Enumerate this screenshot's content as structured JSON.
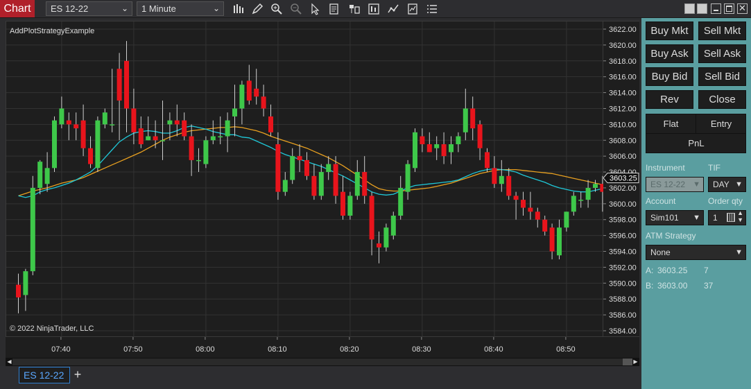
{
  "window": {
    "title_tab": "Chart"
  },
  "toolbar": {
    "instrument": "ES 12-22",
    "interval": "1 Minute",
    "icons": [
      "bar-type-icon",
      "draw-pencil-icon",
      "zoom-in-icon",
      "zoom-out-icon",
      "pointer-icon",
      "properties-icon",
      "instrument-overlay-icon",
      "chart-trader-icon",
      "strategies-icon",
      "indicators-icon",
      "list-icon"
    ]
  },
  "chart": {
    "label": "AddPlotStrategyExample",
    "copyright": "© 2022 NinjaTrader, LLC",
    "price_labels": [
      "3622.00",
      "3620.00",
      "3618.00",
      "3616.00",
      "3614.00",
      "3612.00",
      "3610.00",
      "3608.00",
      "3606.00",
      "3604.00",
      "3602.00",
      "3600.00",
      "3598.00",
      "3596.00",
      "3594.00",
      "3592.00",
      "3590.00",
      "3588.00",
      "3586.00",
      "3584.00"
    ],
    "time_labels": [
      "07:40",
      "07:50",
      "08:00",
      "08:10",
      "08:20",
      "08:30",
      "08:40",
      "08:50"
    ],
    "current_price": "3603.25",
    "colors": {
      "up": "#3ec84a",
      "down": "#e8141c",
      "wick": "#cfcfcf",
      "sma_fast": "#1fc8d8",
      "sma_slow": "#e8a020",
      "bg": "#1e1e1e",
      "grid": "#333"
    }
  },
  "chart_data": {
    "type": "candlestick",
    "ylim": [
      3583,
      3623
    ],
    "candles": [
      [
        3589.8,
        3591.2,
        3586.2,
        3588.2
      ],
      [
        3588.5,
        3591.8,
        3586.5,
        3591.5
      ],
      [
        3591.5,
        3603.5,
        3591.0,
        3602.0
      ],
      [
        3602.0,
        3605.5,
        3601.2,
        3605.3
      ],
      [
        3602.5,
        3606.5,
        3601.5,
        3604.5
      ],
      [
        3604.5,
        3611.0,
        3604.0,
        3610.5
      ],
      [
        3610.0,
        3613.5,
        3609.5,
        3612.0
      ],
      [
        3610.5,
        3611.5,
        3608.0,
        3610.0
      ],
      [
        3610.0,
        3611.5,
        3608.0,
        3609.5
      ],
      [
        3610.5,
        3612.5,
        3606.0,
        3607.0
      ],
      [
        3607.0,
        3608.5,
        3604.5,
        3605.0
      ],
      [
        3604.5,
        3611.0,
        3604.0,
        3610.5
      ],
      [
        3610.0,
        3612.0,
        3609.5,
        3611.5
      ],
      [
        3610.0,
        3617.0,
        3609.0,
        3610.0
      ],
      [
        3617.0,
        3619.0,
        3608.0,
        3613.0
      ],
      [
        3618.0,
        3620.5,
        3609.0,
        3612.0
      ],
      [
        3612.0,
        3614.5,
        3607.5,
        3609.0
      ],
      [
        3609.5,
        3611.0,
        3607.0,
        3607.5
      ],
      [
        3608.0,
        3611.0,
        3608.0,
        3608.5
      ],
      [
        3608.5,
        3610.5,
        3607.0,
        3608.0
      ],
      [
        3608.0,
        3613.0,
        3605.5,
        3608.0
      ],
      [
        3610.0,
        3611.5,
        3608.0,
        3610.5
      ],
      [
        3610.5,
        3612.5,
        3608.5,
        3610.0
      ],
      [
        3610.5,
        3611.5,
        3608.0,
        3608.5
      ],
      [
        3608.5,
        3610.0,
        3603.5,
        3605.5
      ],
      [
        3605.5,
        3607.0,
        3604.0,
        3605.5
      ],
      [
        3605.0,
        3608.5,
        3604.5,
        3608.0
      ],
      [
        3608.0,
        3610.5,
        3607.5,
        3608.5
      ],
      [
        3608.5,
        3611.0,
        3607.5,
        3608.5
      ],
      [
        3608.5,
        3611.5,
        3606.5,
        3610.5
      ],
      [
        3611.0,
        3615.0,
        3608.5,
        3612.0
      ],
      [
        3612.0,
        3615.5,
        3610.0,
        3615.0
      ],
      [
        3615.5,
        3617.5,
        3612.5,
        3613.0
      ],
      [
        3614.5,
        3617.0,
        3612.5,
        3613.5
      ],
      [
        3613.5,
        3615.0,
        3611.0,
        3612.0
      ],
      [
        3611.0,
        3612.5,
        3608.5,
        3609.0
      ],
      [
        3607.5,
        3609.0,
        3600.5,
        3601.5
      ],
      [
        3601.5,
        3604.0,
        3601.0,
        3603.0
      ],
      [
        3603.0,
        3607.0,
        3602.5,
        3606.0
      ],
      [
        3606.0,
        3607.5,
        3604.0,
        3605.5
      ],
      [
        3605.5,
        3606.5,
        3603.0,
        3603.5
      ],
      [
        3603.5,
        3605.0,
        3600.5,
        3601.0
      ],
      [
        3601.0,
        3605.0,
        3600.5,
        3604.0
      ],
      [
        3604.0,
        3606.0,
        3603.0,
        3605.0
      ],
      [
        3605.0,
        3606.0,
        3600.0,
        3601.0
      ],
      [
        3601.5,
        3603.5,
        3598.0,
        3598.5
      ],
      [
        3598.5,
        3601.5,
        3598.0,
        3601.0
      ],
      [
        3601.0,
        3605.5,
        3600.5,
        3604.0
      ],
      [
        3604.0,
        3606.0,
        3600.0,
        3601.0
      ],
      [
        3601.0,
        3601.5,
        3593.5,
        3595.5
      ],
      [
        3595.0,
        3596.5,
        3592.5,
        3594.5
      ],
      [
        3594.5,
        3597.5,
        3594.0,
        3597.0
      ],
      [
        3596.0,
        3599.0,
        3595.5,
        3598.5
      ],
      [
        3598.5,
        3603.5,
        3598.0,
        3602.0
      ],
      [
        3601.5,
        3605.5,
        3600.5,
        3605.0
      ],
      [
        3604.5,
        3609.5,
        3604.0,
        3609.0
      ],
      [
        3608.5,
        3609.5,
        3606.5,
        3607.5
      ],
      [
        3607.5,
        3609.0,
        3606.5,
        3606.5
      ],
      [
        3607.0,
        3608.5,
        3605.5,
        3607.5
      ],
      [
        3607.5,
        3609.0,
        3605.0,
        3606.0
      ],
      [
        3606.5,
        3608.5,
        3605.0,
        3607.5
      ],
      [
        3607.5,
        3609.0,
        3606.5,
        3608.5
      ],
      [
        3609.0,
        3614.5,
        3608.0,
        3612.0
      ],
      [
        3612.0,
        3613.5,
        3608.0,
        3609.5
      ],
      [
        3610.0,
        3610.5,
        3605.5,
        3607.0
      ],
      [
        3606.5,
        3607.0,
        3604.0,
        3604.5
      ],
      [
        3604.5,
        3606.0,
        3602.0,
        3602.5
      ],
      [
        3602.5,
        3605.5,
        3601.5,
        3603.5
      ],
      [
        3603.5,
        3604.5,
        3600.5,
        3601.0
      ],
      [
        3601.0,
        3601.5,
        3598.0,
        3600.5
      ],
      [
        3600.5,
        3601.5,
        3598.5,
        3599.5
      ],
      [
        3599.5,
        3601.5,
        3598.0,
        3599.0
      ],
      [
        3599.0,
        3599.5,
        3597.0,
        3598.0
      ],
      [
        3598.0,
        3598.5,
        3596.0,
        3596.5
      ],
      [
        3597.0,
        3597.5,
        3593.0,
        3594.0
      ],
      [
        3593.5,
        3598.0,
        3593.0,
        3597.0
      ],
      [
        3597.0,
        3599.0,
        3596.5,
        3599.0
      ],
      [
        3599.0,
        3601.5,
        3598.5,
        3601.0
      ],
      [
        3600.5,
        3601.5,
        3599.5,
        3600.5
      ],
      [
        3600.5,
        3603.0,
        3599.5,
        3602.0
      ],
      [
        3602.0,
        3603.0,
        3601.5,
        3602.5
      ],
      [
        3602.5,
        3603.5,
        3599.0,
        3601.5
      ],
      [
        3601.5,
        3604.0,
        3600.5,
        3603.25
      ]
    ],
    "sma_fast": [
      3601.0,
      3600.8,
      3601.0,
      3601.5,
      3601.8,
      3602.0,
      3602.3,
      3602.6,
      3603.0,
      3603.5,
      3604.0,
      3604.8,
      3605.8,
      3606.8,
      3607.8,
      3608.4,
      3608.9,
      3609.1,
      3609.2,
      3609.1,
      3608.9,
      3608.9,
      3609.2,
      3609.6,
      3609.8,
      3609.6,
      3609.4,
      3609.1,
      3608.9,
      3608.7,
      3608.7,
      3608.4,
      3608.3,
      3607.9,
      3607.5,
      3607.1,
      3606.6,
      3606.2,
      3605.9,
      3605.6,
      3605.3,
      3605.0,
      3604.7,
      3604.3,
      3603.9,
      3603.5,
      3603.0,
      3602.5,
      3602.0,
      3601.5,
      3601.2,
      3601.1,
      3601.2,
      3601.6,
      3602.0,
      3602.3,
      3602.4,
      3602.5,
      3602.6,
      3602.7,
      3602.8,
      3603.0,
      3603.4,
      3603.8,
      3604.1,
      3604.3,
      3604.4,
      3604.3,
      3604.2,
      3604.0,
      3603.6,
      3603.3,
      3603.0,
      3602.7,
      3602.3,
      3602.0,
      3601.8,
      3601.6,
      3601.5,
      3601.5,
      3601.7,
      3601.9,
      3602.1
    ],
    "sma_slow": [
      3601.0,
      3601.3,
      3601.6,
      3601.8,
      3602.0,
      3602.3,
      3602.6,
      3602.8,
      3603.0,
      3603.3,
      3603.7,
      3604.1,
      3604.5,
      3604.9,
      3605.3,
      3605.7,
      3606.1,
      3606.5,
      3607.0,
      3607.5,
      3608.0,
      3608.4,
      3608.7,
      3609.0,
      3609.2,
      3609.3,
      3609.4,
      3609.5,
      3609.6,
      3609.6,
      3609.7,
      3609.6,
      3609.4,
      3609.2,
      3608.9,
      3608.5,
      3608.2,
      3607.9,
      3607.6,
      3607.3,
      3607.0,
      3606.6,
      3606.2,
      3605.8,
      3605.3,
      3604.8,
      3604.2,
      3603.6,
      3603.0,
      3602.4,
      3601.9,
      3601.7,
      3601.6,
      3601.6,
      3601.7,
      3601.8,
      3601.9,
      3602.0,
      3602.2,
      3602.4,
      3602.6,
      3602.9,
      3603.2,
      3603.5,
      3603.8,
      3604.0,
      3604.2,
      3604.3,
      3604.3,
      3604.3,
      3604.2,
      3604.1,
      3604.0,
      3603.9,
      3603.8,
      3603.6,
      3603.4,
      3603.2,
      3603.0,
      3602.8,
      3602.6,
      3602.4,
      3602.3
    ],
    "x_tick_candle_index": [
      6,
      16,
      26,
      36,
      46,
      56,
      66,
      76
    ]
  },
  "chart_trader": {
    "buttons": [
      "Buy Mkt",
      "Sell Mkt",
      "Buy Ask",
      "Sell Ask",
      "Buy Bid",
      "Sell Bid",
      "Rev",
      "Close"
    ],
    "flat": "Flat",
    "entry": "Entry",
    "pnl": "PnL",
    "instrument_label": "Instrument",
    "tif_label": "TIF",
    "instrument_value": "ES 12-22",
    "tif_value": "DAY",
    "account_label": "Account",
    "orderqty_label": "Order qty",
    "account_value": "Sim101",
    "orderqty_value": "1",
    "atm_label": "ATM Strategy",
    "atm_value": "None",
    "ask_label": "A:",
    "ask_price": "3603.25",
    "ask_size": "7",
    "bid_label": "B:",
    "bid_price": "3603.00",
    "bid_size": "37"
  },
  "bottom": {
    "tab_label": "ES 12-22",
    "add_tab": "+"
  }
}
